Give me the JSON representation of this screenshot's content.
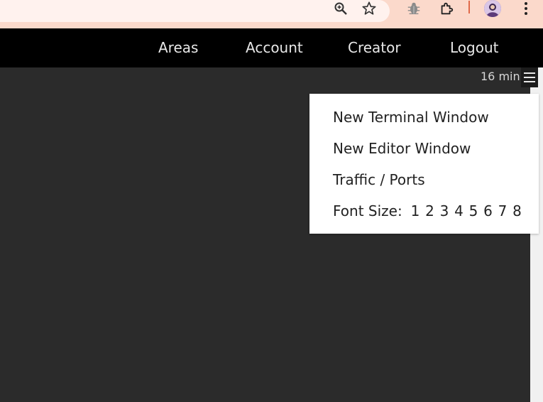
{
  "browser": {
    "icons": [
      "zoom-icon",
      "star-icon",
      "bug-icon",
      "extensions-icon",
      "avatar",
      "kebab-menu-icon"
    ],
    "accent_color": "#e06a4a"
  },
  "navbar": {
    "links": [
      {
        "label": "Areas"
      },
      {
        "label": "Account"
      },
      {
        "label": "Creator"
      },
      {
        "label": "Logout"
      }
    ]
  },
  "workspace": {
    "timer": "16 min"
  },
  "menu": {
    "items": [
      {
        "label": "New Terminal Window"
      },
      {
        "label": "New Editor Window"
      },
      {
        "label": "Traffic / Ports"
      }
    ],
    "font_size": {
      "label": "Font Size:",
      "options": [
        "1",
        "2",
        "3",
        "4",
        "5",
        "6",
        "7",
        "8"
      ]
    }
  }
}
